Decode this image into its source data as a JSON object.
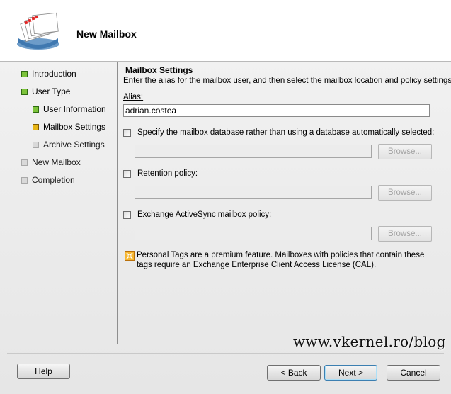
{
  "header": {
    "title": "New Mailbox",
    "icon": "mailbox-stack-icon"
  },
  "nav": {
    "items": [
      {
        "label": "Introduction",
        "state": "complete"
      },
      {
        "label": "User Type",
        "state": "complete"
      },
      {
        "label": "User Information",
        "state": "complete"
      },
      {
        "label": "Mailbox Settings",
        "state": "current"
      },
      {
        "label": "Archive Settings",
        "state": "pending"
      },
      {
        "label": "New Mailbox",
        "state": "pending"
      },
      {
        "label": "Completion",
        "state": "pending"
      }
    ]
  },
  "main": {
    "section_title": "Mailbox Settings",
    "description": "Enter the alias for the mailbox user, and then select the mailbox location and policy settings.",
    "alias_label": "Alias:",
    "alias_value": "adrian.costea",
    "options": [
      {
        "label": "Specify the mailbox database rather than using a database automatically selected:",
        "checked": false,
        "browse": "Browse..."
      },
      {
        "label": "Retention policy:",
        "checked": false,
        "browse": "Browse..."
      },
      {
        "label": "Exchange ActiveSync mailbox policy:",
        "checked": false,
        "browse": "Browse..."
      }
    ],
    "info_text": "Personal Tags are a premium feature. Mailboxes with policies that contain these tags require an Exchange Enterprise Client Access License (CAL)."
  },
  "watermark": "www.vkernel.ro/blog",
  "footer": {
    "help": "Help",
    "back": "< Back",
    "next": "Next >",
    "cancel": "Cancel"
  },
  "colors": {
    "complete": "#7cc33a",
    "current": "#e7b517",
    "pending": "#d9d9d9"
  }
}
